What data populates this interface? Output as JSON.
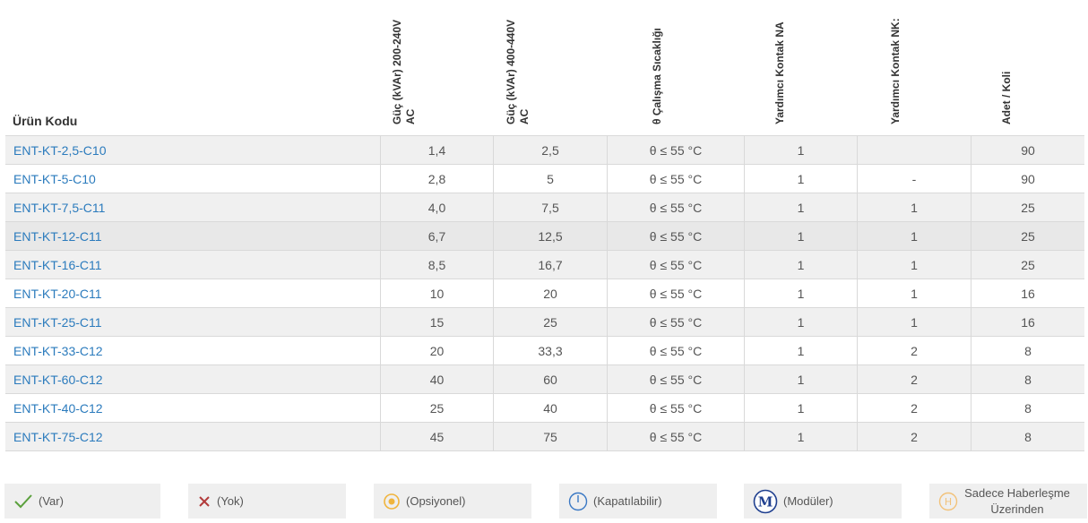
{
  "table": {
    "headers": [
      "Ürün Kodu",
      "Güç (kVAr) 200-240V AC",
      "Güç (kVAr) 400-440V AC",
      "θ Çalışma Sıcaklığı",
      "Yardımcı Kontak NA",
      "Yardımcı Kontak NK:",
      "Adet / Koli"
    ],
    "rows": [
      [
        "ENT-KT-2,5-C10",
        "1,4",
        "2,5",
        "θ ≤ 55 °C",
        "1",
        "",
        "90"
      ],
      [
        "ENT-KT-5-C10",
        "2,8",
        "5",
        "θ ≤ 55 °C",
        "1",
        "-",
        "90"
      ],
      [
        "ENT-KT-7,5-C11",
        "4,0",
        "7,5",
        "θ ≤ 55 °C",
        "1",
        "1",
        "25"
      ],
      [
        "ENT-KT-12-C11",
        "6,7",
        "12,5",
        "θ ≤ 55 °C",
        "1",
        "1",
        "25"
      ],
      [
        "ENT-KT-16-C11",
        "8,5",
        "16,7",
        "θ ≤ 55 °C",
        "1",
        "1",
        "25"
      ],
      [
        "ENT-KT-20-C11",
        "10",
        "20",
        "θ ≤ 55 °C",
        "1",
        "1",
        "16"
      ],
      [
        "ENT-KT-25-C11",
        "15",
        "25",
        "θ ≤ 55 °C",
        "1",
        "1",
        "16"
      ],
      [
        "ENT-KT-33-C12",
        "20",
        "33,3",
        "θ ≤ 55 °C",
        "1",
        "2",
        "8"
      ],
      [
        "ENT-KT-60-C12",
        "40",
        "60",
        "θ ≤ 55 °C",
        "1",
        "2",
        "8"
      ],
      [
        "ENT-KT-40-C12",
        "25",
        "40",
        "θ ≤ 55 °C",
        "1",
        "2",
        "8"
      ],
      [
        "ENT-KT-75-C12",
        "45",
        "75",
        "θ ≤ 55 °C",
        "1",
        "2",
        "8"
      ]
    ]
  },
  "legend": [
    {
      "icon": "check-icon",
      "label": "(Var)"
    },
    {
      "icon": "cross-icon",
      "label": "(Yok)"
    },
    {
      "icon": "optional-icon",
      "label": "(Opsiyonel)"
    },
    {
      "icon": "power-icon",
      "label": "(Kapatılabilir)"
    },
    {
      "icon": "modular-icon",
      "label": "(Modüler)",
      "glyph": "M"
    },
    {
      "icon": "communication-icon",
      "label": "Sadece Haberleşme Üzerinden",
      "glyph": "H"
    }
  ],
  "colors": {
    "link": "#2b7bbd",
    "check": "#5aa03c",
    "cross": "#b23b3b",
    "optional": "#f0b43c",
    "power": "#3a78c4",
    "modular": "#1f3f8f",
    "communication": "#f2c27a"
  }
}
